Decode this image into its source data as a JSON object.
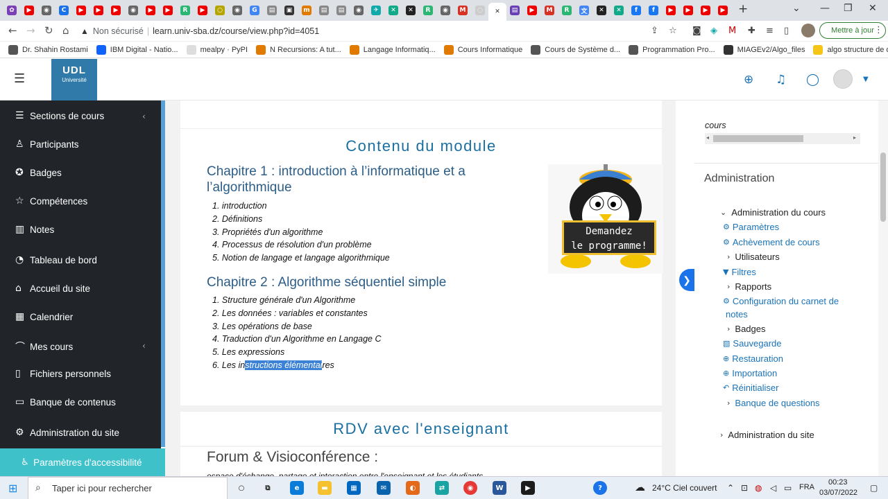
{
  "browser": {
    "tabs": [
      {
        "icon": "tab-icon",
        "color": "#7b3fb5",
        "glyph": "✿"
      },
      {
        "icon": "youtube-icon",
        "color": "#e00",
        "glyph": "▶"
      },
      {
        "icon": "globe-icon",
        "color": "#666",
        "glyph": "◉"
      },
      {
        "icon": "chrome-c-icon",
        "color": "#1a73e8",
        "glyph": "C"
      },
      {
        "icon": "youtube-icon",
        "color": "#e00",
        "glyph": "▶"
      },
      {
        "icon": "youtube-icon",
        "color": "#e00",
        "glyph": "▶"
      },
      {
        "icon": "youtube-icon",
        "color": "#e00",
        "glyph": "▶"
      },
      {
        "icon": "globe-icon",
        "color": "#666",
        "glyph": "◉"
      },
      {
        "icon": "youtube-icon",
        "color": "#e00",
        "glyph": "▶"
      },
      {
        "icon": "youtube-icon",
        "color": "#e00",
        "glyph": "▶"
      },
      {
        "icon": "tab-icon",
        "color": "#2bb673",
        "glyph": "R"
      },
      {
        "icon": "youtube-icon",
        "color": "#e00",
        "glyph": "▶"
      },
      {
        "icon": "tab-icon",
        "color": "#b5a500",
        "glyph": "○"
      },
      {
        "icon": "globe-icon",
        "color": "#666",
        "glyph": "◉"
      },
      {
        "icon": "google-icon",
        "color": "#4285f4",
        "glyph": "G"
      },
      {
        "icon": "doc-icon",
        "color": "#888",
        "glyph": "▤"
      },
      {
        "icon": "tab-icon",
        "color": "#333",
        "glyph": "▣"
      },
      {
        "icon": "tab-icon",
        "color": "#e07a00",
        "glyph": "m"
      },
      {
        "icon": "doc-icon",
        "color": "#888",
        "glyph": "▤"
      },
      {
        "icon": "doc-icon",
        "color": "#888",
        "glyph": "▤"
      },
      {
        "icon": "globe-icon",
        "color": "#666",
        "glyph": "◉"
      },
      {
        "icon": "tab-icon",
        "color": "#1aa",
        "glyph": "✈"
      },
      {
        "icon": "tab-icon",
        "color": "#1a8",
        "glyph": "✕"
      },
      {
        "icon": "tab-icon",
        "color": "#222",
        "glyph": "✕"
      },
      {
        "icon": "tab-icon",
        "color": "#2bb673",
        "glyph": "R"
      },
      {
        "icon": "globe-icon",
        "color": "#666",
        "glyph": "◉"
      },
      {
        "icon": "gmail-icon",
        "color": "#d93025",
        "glyph": "M"
      },
      {
        "icon": "tab-icon",
        "color": "#ccc",
        "glyph": "◌"
      },
      {
        "icon": "close-icon",
        "color": "#333",
        "glyph": "✕",
        "active": true
      },
      {
        "icon": "tab-icon",
        "color": "#6a3fb5",
        "glyph": "▤"
      },
      {
        "icon": "youtube-icon",
        "color": "#e00",
        "glyph": "▶"
      },
      {
        "icon": "gmail-icon",
        "color": "#d93025",
        "glyph": "M"
      },
      {
        "icon": "tab-icon",
        "color": "#2bb673",
        "glyph": "R"
      },
      {
        "icon": "translate-icon",
        "color": "#4285f4",
        "glyph": "文"
      },
      {
        "icon": "tab-icon",
        "color": "#222",
        "glyph": "✕"
      },
      {
        "icon": "tab-icon",
        "color": "#1a8",
        "glyph": "✕"
      },
      {
        "icon": "facebook-icon",
        "color": "#1877f2",
        "glyph": "f"
      },
      {
        "icon": "facebook-icon",
        "color": "#1877f2",
        "glyph": "f"
      },
      {
        "icon": "youtube-icon",
        "color": "#e00",
        "glyph": "▶"
      },
      {
        "icon": "youtube-icon",
        "color": "#e00",
        "glyph": "▶"
      },
      {
        "icon": "youtube-icon",
        "color": "#e00",
        "glyph": "▶"
      },
      {
        "icon": "youtube-icon",
        "color": "#e00",
        "glyph": "▶"
      }
    ],
    "new_tab": "+",
    "address": {
      "security": "Non sécurisé",
      "url": "learn.univ-sba.dz/course/view.php?id=4051"
    },
    "update_button": "Mettre à jour",
    "bookmarks": [
      {
        "label": "Dr. Shahin Rostami",
        "color": "#555"
      },
      {
        "label": "IBM Digital - Natio...",
        "color": "#0f62fe"
      },
      {
        "label": "mealpy · PyPI",
        "color": "#ddd"
      },
      {
        "label": "N Recursions: A tut...",
        "color": "#e07a00"
      },
      {
        "label": "Langage Informatiq...",
        "color": "#e07a00"
      },
      {
        "label": "Cours Informatique",
        "color": "#e07a00"
      },
      {
        "label": "Cours de Système d...",
        "color": "#555"
      },
      {
        "label": "Programmation Pro...",
        "color": "#555"
      },
      {
        "label": "MIAGEv2/Algo_files",
        "color": "#333"
      },
      {
        "label": "algo structure de d...",
        "color": "#f5c518"
      }
    ]
  },
  "header": {
    "logo_text": "UDL",
    "logo_sub": "Université"
  },
  "sidebar": {
    "items": [
      {
        "label": "Sections de cours",
        "icon": "list-icon",
        "glyph": "☰",
        "chevron": true
      },
      {
        "label": "Participants",
        "icon": "users-icon",
        "glyph": "♙"
      },
      {
        "label": "Badges",
        "icon": "badge-icon",
        "glyph": "✪"
      },
      {
        "label": "Compétences",
        "icon": "star-icon",
        "glyph": "☆"
      },
      {
        "label": "Notes",
        "icon": "notes-icon",
        "glyph": "▥"
      },
      {
        "label": "Tableau de bord",
        "icon": "dashboard-icon",
        "glyph": "◔"
      },
      {
        "label": "Accueil du site",
        "icon": "home-icon",
        "glyph": "⌂"
      },
      {
        "label": "Calendrier",
        "icon": "calendar-icon",
        "glyph": "▦"
      },
      {
        "label": "Mes cours",
        "icon": "graduation-icon",
        "glyph": "⌒",
        "chevron": true
      },
      {
        "label": "Fichiers personnels",
        "icon": "file-icon",
        "glyph": "▯"
      },
      {
        "label": "Banque de contenus",
        "icon": "content-bank-icon",
        "glyph": "▭"
      },
      {
        "label": "Administration du site",
        "icon": "gear-icon",
        "glyph": "⚙"
      }
    ],
    "accessibility": "Paramètres d'accessibilité"
  },
  "main": {
    "section1_title": "Contenu du module",
    "chapter1": {
      "title_line1": "Chapitre 1 : introduction à l’informatique et a",
      "title_line2": "l’algorithmique",
      "items": [
        "1. introduction",
        "2. Définitions",
        "3. Propriétés d'un algorithme",
        "4. Processus de résolution d'un problème",
        "5. Notion de langage et langage algorithmique"
      ]
    },
    "chapter2": {
      "title": "Chapitre 2 : Algorithme séquentiel simple",
      "items": [
        "1. Structure générale d'un Algorithme",
        "2. Les données : variables et constantes",
        "3. Les opérations de base",
        "4. Traduction d'un Algorithme en Langage C",
        "5. Les expressions"
      ],
      "item6_before": "6. Les in",
      "item6_selected": "structions élémentai",
      "item6_after": "res"
    },
    "penguin_sign_line1": "Demandez",
    "penguin_sign_line2": "le programme!",
    "section2_title": "RDV avec l'enseignant",
    "forum_title": "Forum & Visioconférence :",
    "forum_sub": "espace d'échange, partage et interaction entre l'enseignant et les étudiants"
  },
  "right_panel": {
    "cours_label": "cours",
    "admin_heading": "Administration",
    "items": [
      {
        "label": "Administration du cours",
        "type": "expanded",
        "indent": 1
      },
      {
        "label": "Paramètres",
        "type": "link",
        "icon": "gear-icon",
        "glyph": "⚙",
        "indent": 0
      },
      {
        "label": "Achèvement de cours",
        "type": "link",
        "icon": "gear-icon",
        "glyph": "⚙",
        "indent": 0
      },
      {
        "label": "Utilisateurs",
        "type": "collapsed",
        "indent": 2
      },
      {
        "label": "Filtres",
        "type": "link",
        "icon": "filter-icon",
        "glyph": "▼",
        "indent": 0
      },
      {
        "label": "Rapports",
        "type": "collapsed",
        "indent": 2
      },
      {
        "label": "Configuration du carnet de",
        "type": "link",
        "icon": "gear-icon",
        "glyph": "⚙",
        "indent": 0
      },
      {
        "label": "notes",
        "type": "cont",
        "indent": 0
      },
      {
        "label": "Badges",
        "type": "collapsed",
        "indent": 2
      },
      {
        "label": "Sauvegarde",
        "type": "link",
        "icon": "file-icon",
        "glyph": "▧",
        "indent": 0
      },
      {
        "label": "Restauration",
        "type": "link",
        "icon": "upload-icon",
        "glyph": "⊕",
        "indent": 0
      },
      {
        "label": "Importation",
        "type": "link",
        "icon": "upload-icon",
        "glyph": "⊕",
        "indent": 0
      },
      {
        "label": "Réinitialiser",
        "type": "link",
        "icon": "reset-icon",
        "glyph": "↶",
        "indent": 0
      },
      {
        "label": "Banque de questions",
        "type": "collapsed-link",
        "indent": 2
      },
      {
        "label": "Administration du site",
        "type": "collapsed",
        "indent": 1
      }
    ]
  },
  "taskbar": {
    "search_placeholder": "Taper ici pour rechercher",
    "weather": "24°C  Ciel couvert",
    "lang": "FRA",
    "time": "00:23",
    "date": "03/07/2022"
  }
}
